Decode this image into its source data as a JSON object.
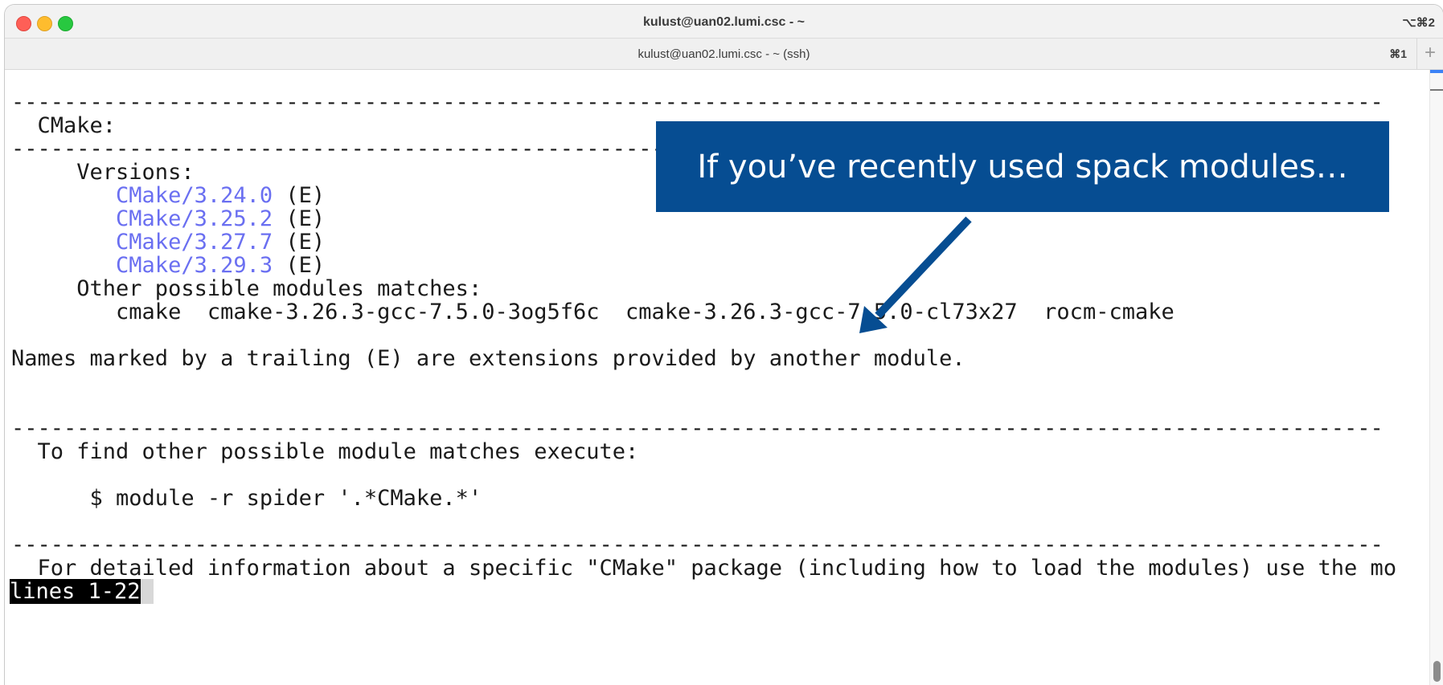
{
  "window": {
    "title": "kulust@uan02.lumi.csc - ~",
    "shortcut": "⌥⌘2"
  },
  "tab": {
    "title": "kulust@uan02.lumi.csc - ~ (ssh)",
    "shortcut": "⌘1",
    "new_tab_label": "+"
  },
  "terminal": {
    "rule": "---------------------------------------------------------------------------------------------------------",
    "header": "  CMake:",
    "versions_label": "     Versions:",
    "versions": [
      {
        "name": "CMake/3.24.0",
        "suffix": " (E)"
      },
      {
        "name": "CMake/3.25.2",
        "suffix": " (E)"
      },
      {
        "name": "CMake/3.27.7",
        "suffix": " (E)"
      },
      {
        "name": "CMake/3.29.3",
        "suffix": " (E)"
      }
    ],
    "other_label": "     Other possible modules matches:",
    "other_matches": "        cmake  cmake-3.26.3-gcc-7.5.0-3og5f6c  cmake-3.26.3-gcc-7.5.0-cl73x27  rocm-cmake",
    "extensions_note": "Names marked by a trailing (E) are extensions provided by another module.",
    "find_other": "  To find other possible module matches execute:",
    "command": "      $ module -r spider '.*CMake.*'",
    "detailed_info": "  For detailed information about a specific \"CMake\" package (including how to load the modules) use the mo",
    "pager_status": "lines 1-22"
  },
  "callout": {
    "text": "If you’ve recently used spack modules…",
    "background": "#064d92",
    "text_color": "#ffffff"
  },
  "colors": {
    "module_link": "#6a6ff1",
    "terminal_text": "#1a1a1a"
  }
}
